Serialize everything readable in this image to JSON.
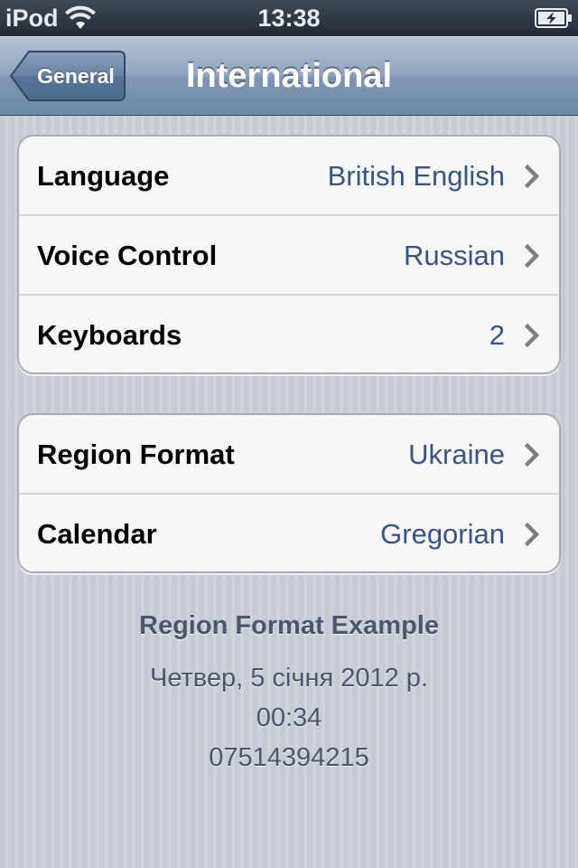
{
  "status_bar": {
    "carrier": "iPod",
    "time": "13:38",
    "wifi_icon": "wifi-icon",
    "battery_icon": "battery-charging-icon"
  },
  "nav_bar": {
    "back_label": "General",
    "title": "International"
  },
  "groups": [
    {
      "cells": [
        {
          "label": "Language",
          "value": "British English"
        },
        {
          "label": "Voice Control",
          "value": "Russian"
        },
        {
          "label": "Keyboards",
          "value": "2"
        }
      ]
    },
    {
      "cells": [
        {
          "label": "Region Format",
          "value": "Ukraine"
        },
        {
          "label": "Calendar",
          "value": "Gregorian"
        }
      ]
    }
  ],
  "region_example": {
    "heading": "Region Format Example",
    "date": "Четвер, 5 січня 2012 р.",
    "time": "00:34",
    "phone": "07514394215"
  },
  "colors": {
    "nav_bar": "#8ea4bd",
    "value_text": "#385487",
    "background": "#c9ced6"
  }
}
